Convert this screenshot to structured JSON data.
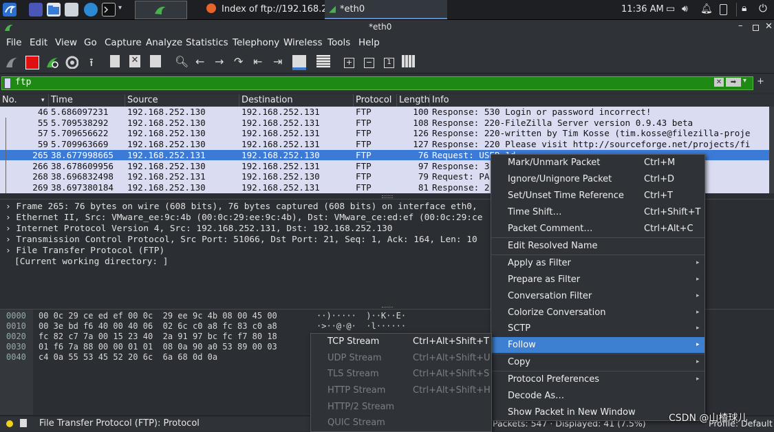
{
  "taskbar": {
    "task1_label": "Index of ftp://192.168.25...",
    "task2_label": "*eth0",
    "clock": "11:36 AM"
  },
  "window": {
    "title": "*eth0"
  },
  "menu": [
    "File",
    "Edit",
    "View",
    "Go",
    "Capture",
    "Analyze",
    "Statistics",
    "Telephony",
    "Wireless",
    "Tools",
    "Help"
  ],
  "filter": {
    "value": "ftp"
  },
  "columns": [
    "No.",
    "Time",
    "Source",
    "Destination",
    "Protocol",
    "Length",
    "Info"
  ],
  "packets": [
    {
      "no": "46",
      "time": "5.686097231",
      "src": "192.168.252.130",
      "dst": "192.168.252.131",
      "proto": "FTP",
      "len": "100",
      "info": "Response: 530 Login or password incorrect!"
    },
    {
      "no": "55",
      "time": "5.709538292",
      "src": "192.168.252.130",
      "dst": "192.168.252.131",
      "proto": "FTP",
      "len": "108",
      "info": "Response: 220-FileZilla Server version 0.9.43 beta"
    },
    {
      "no": "57",
      "time": "5.709656622",
      "src": "192.168.252.130",
      "dst": "192.168.252.131",
      "proto": "FTP",
      "len": "126",
      "info": "Response: 220-written by Tim Kosse (tim.kosse@filezilla-proje"
    },
    {
      "no": "59",
      "time": "5.709963669",
      "src": "192.168.252.130",
      "dst": "192.168.252.131",
      "proto": "FTP",
      "len": "127",
      "info": "Response: 220 Please visit http://sourceforge.net/projects/fi"
    },
    {
      "no": "265",
      "time": "38.677998665",
      "src": "192.168.252.131",
      "dst": "192.168.252.130",
      "proto": "FTP",
      "len": "76",
      "info": "Request: USER 1d"
    },
    {
      "no": "266",
      "time": "38.678609956",
      "src": "192.168.252.130",
      "dst": "192.168.252.131",
      "proto": "FTP",
      "len": "97",
      "info": "Response: 3"
    },
    {
      "no": "268",
      "time": "38.696832498",
      "src": "192.168.252.131",
      "dst": "192.168.252.130",
      "proto": "FTP",
      "len": "79",
      "info": "Request: PA"
    },
    {
      "no": "269",
      "time": "38.697380184",
      "src": "192.168.252.130",
      "dst": "192.168.252.131",
      "proto": "FTP",
      "len": "81",
      "info": "Response: 2"
    }
  ],
  "details": [
    "Frame 265: 76 bytes on wire (608 bits), 76 bytes captured (608 bits) on interface eth0,",
    "Ethernet II, Src: VMware_ee:9c:4b (00:0c:29:ee:9c:4b), Dst: VMware_ce:ed:ef (00:0c:29:ce",
    "Internet Protocol Version 4, Src: 192.168.252.131, Dst: 192.168.252.130",
    "Transmission Control Protocol, Src Port: 51066, Dst Port: 21, Seq: 1, Ack: 164, Len: 10",
    "File Transfer Protocol (FTP)",
    "[Current working directory: ]"
  ],
  "bytes": {
    "offsets": [
      "0000",
      "0010",
      "0020",
      "0030",
      "0040"
    ],
    "hex": [
      "00 0c 29 ce ed ef 00 0c  29 ee 9c 4b 08 00 45 00",
      "00 3e bd f6 40 00 40 06  02 6c c0 a8 fc 83 c0 a8",
      "fc 82 c7 7a 00 15 23 40  2a 91 97 bc fc f7 80 18",
      "01 f6 7a 88 00 00 01 01  08 0a 90 a0 53 89 00 03",
      "c4 0a 55 53 45 52 20 6c  6a 68 0d 0a"
    ],
    "ascii": [
      "··)·····  )··K··E·",
      "·>··@·@·  ·l······"
    ]
  },
  "context_menu": [
    {
      "label": "Mark/Unmark Packet",
      "shortcut": "Ctrl+M"
    },
    {
      "label": "Ignore/Unignore Packet",
      "shortcut": "Ctrl+D"
    },
    {
      "label": "Set/Unset Time Reference",
      "shortcut": "Ctrl+T"
    },
    {
      "label": "Time Shift…",
      "shortcut": "Ctrl+Shift+T"
    },
    {
      "label": "Packet Comment…",
      "shortcut": "Ctrl+Alt+C"
    },
    {
      "label": "Edit Resolved Name",
      "shortcut": ""
    },
    {
      "label": "Apply as Filter",
      "shortcut": "",
      "submenu": true
    },
    {
      "label": "Prepare as Filter",
      "shortcut": "",
      "submenu": true
    },
    {
      "label": "Conversation Filter",
      "shortcut": "",
      "submenu": true
    },
    {
      "label": "Colorize Conversation",
      "shortcut": "",
      "submenu": true
    },
    {
      "label": "SCTP",
      "shortcut": "",
      "submenu": true
    },
    {
      "label": "Follow",
      "shortcut": "",
      "submenu": true
    },
    {
      "label": "Copy",
      "shortcut": "",
      "submenu": true
    },
    {
      "label": "Protocol Preferences",
      "shortcut": "",
      "submenu": true
    },
    {
      "label": "Decode As…",
      "shortcut": ""
    },
    {
      "label": "Show Packet in New Window",
      "shortcut": ""
    }
  ],
  "follow_submenu": [
    {
      "label": "TCP Stream",
      "shortcut": "Ctrl+Alt+Shift+T",
      "enabled": true
    },
    {
      "label": "UDP Stream",
      "shortcut": "Ctrl+Alt+Shift+U",
      "enabled": false
    },
    {
      "label": "TLS Stream",
      "shortcut": "Ctrl+Alt+Shift+S",
      "enabled": false
    },
    {
      "label": "HTTP Stream",
      "shortcut": "Ctrl+Alt+Shift+H",
      "enabled": false
    },
    {
      "label": "HTTP/2 Stream",
      "shortcut": "",
      "enabled": false
    },
    {
      "label": "QUIC Stream",
      "shortcut": "",
      "enabled": false
    }
  ],
  "status": {
    "text": "File Transfer Protocol (FTP): Protocol",
    "counts": "Packets: 547 · Displayed: 41 (7.5%)",
    "profile": "Profile: Default"
  },
  "watermark": "CSDN @山楂球儿",
  "colors": {
    "filter_ok": "#1e8a14",
    "packet_bg": "#dadcf2",
    "selection": "#3b7ad6",
    "highlight": "#3d7fd1"
  }
}
